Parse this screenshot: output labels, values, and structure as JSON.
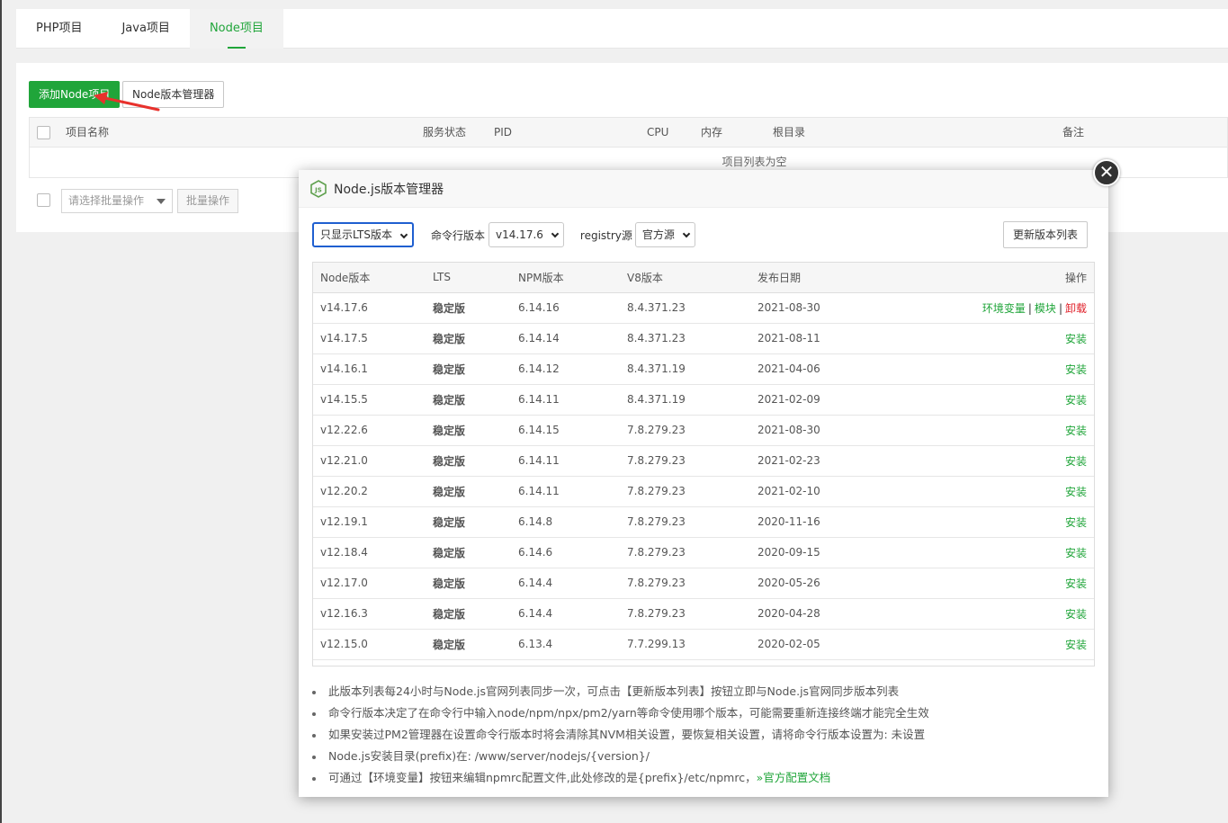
{
  "tabs": [
    {
      "label": "PHP项目",
      "active": false
    },
    {
      "label": "Java项目",
      "active": false
    },
    {
      "label": "Node项目",
      "active": true
    }
  ],
  "toolbar": {
    "add_label": "添加Node项目",
    "version_manager_label": "Node版本管理器"
  },
  "project_table": {
    "headers": [
      "项目名称",
      "服务状态",
      "PID",
      "CPU",
      "内存",
      "根目录",
      "备注"
    ],
    "empty_text": "项目列表为空"
  },
  "batch": {
    "select_placeholder": "请选择批量操作",
    "button_label": "批量操作"
  },
  "modal": {
    "title": "Node.js版本管理器",
    "close_glyph": "✕",
    "filter_value": "只显示LTS版本",
    "cli_label": "命令行版本",
    "cli_value": "v14.17.6",
    "registry_label": "registry源",
    "registry_value": "官方源",
    "refresh_label": "更新版本列表",
    "table_headers": {
      "version": "Node版本",
      "lts": "LTS",
      "npm": "NPM版本",
      "v8": "V8版本",
      "date": "发布日期",
      "op": "操作"
    },
    "installed_actions": {
      "env": "环境变量",
      "module": "模块",
      "uninstall": "卸载",
      "separator": "|"
    },
    "rows": [
      {
        "version": "v14.17.6",
        "lts": "稳定版",
        "npm": "6.14.16",
        "v8": "8.4.371.23",
        "date": "2021-08-30",
        "installed": true,
        "op": ""
      },
      {
        "version": "v14.17.5",
        "lts": "稳定版",
        "npm": "6.14.14",
        "v8": "8.4.371.23",
        "date": "2021-08-11",
        "installed": false,
        "op": "安装"
      },
      {
        "version": "v14.16.1",
        "lts": "稳定版",
        "npm": "6.14.12",
        "v8": "8.4.371.19",
        "date": "2021-04-06",
        "installed": false,
        "op": "安装"
      },
      {
        "version": "v14.15.5",
        "lts": "稳定版",
        "npm": "6.14.11",
        "v8": "8.4.371.19",
        "date": "2021-02-09",
        "installed": false,
        "op": "安装"
      },
      {
        "version": "v12.22.6",
        "lts": "稳定版",
        "npm": "6.14.15",
        "v8": "7.8.279.23",
        "date": "2021-08-30",
        "installed": false,
        "op": "安装"
      },
      {
        "version": "v12.21.0",
        "lts": "稳定版",
        "npm": "6.14.11",
        "v8": "7.8.279.23",
        "date": "2021-02-23",
        "installed": false,
        "op": "安装"
      },
      {
        "version": "v12.20.2",
        "lts": "稳定版",
        "npm": "6.14.11",
        "v8": "7.8.279.23",
        "date": "2021-02-10",
        "installed": false,
        "op": "安装"
      },
      {
        "version": "v12.19.1",
        "lts": "稳定版",
        "npm": "6.14.8",
        "v8": "7.8.279.23",
        "date": "2020-11-16",
        "installed": false,
        "op": "安装"
      },
      {
        "version": "v12.18.4",
        "lts": "稳定版",
        "npm": "6.14.6",
        "v8": "7.8.279.23",
        "date": "2020-09-15",
        "installed": false,
        "op": "安装"
      },
      {
        "version": "v12.17.0",
        "lts": "稳定版",
        "npm": "6.14.4",
        "v8": "7.8.279.23",
        "date": "2020-05-26",
        "installed": false,
        "op": "安装"
      },
      {
        "version": "v12.16.3",
        "lts": "稳定版",
        "npm": "6.14.4",
        "v8": "7.8.279.23",
        "date": "2020-04-28",
        "installed": false,
        "op": "安装"
      },
      {
        "version": "v12.15.0",
        "lts": "稳定版",
        "npm": "6.13.4",
        "v8": "7.7.299.13",
        "date": "2020-02-05",
        "installed": false,
        "op": "安装"
      }
    ],
    "notes": [
      "此版本列表每24小时与Node.js官网列表同步一次，可点击【更新版本列表】按钮立即与Node.js官网同步版本列表",
      "命令行版本决定了在命令行中输入node/npm/npx/pm2/yarn等命令使用哪个版本，可能需要重新连接终端才能完全生效",
      "如果安装过PM2管理器在设置命令行版本时将会清除其NVM相关设置，要恢复相关设置，请将命令行版本设置为: 未设置",
      "Node.js安装目录(prefix)在: /www/server/nodejs/{version}/"
    ],
    "last_note": "可通过【环境变量】按钮来编辑npmrc配置文件,此处修改的是{prefix}/etc/npmrc，",
    "doc_link": "»官方配置文档"
  },
  "colors": {
    "accent": "#20a53a",
    "danger": "#e0212a",
    "focus": "#1f5fd0"
  }
}
